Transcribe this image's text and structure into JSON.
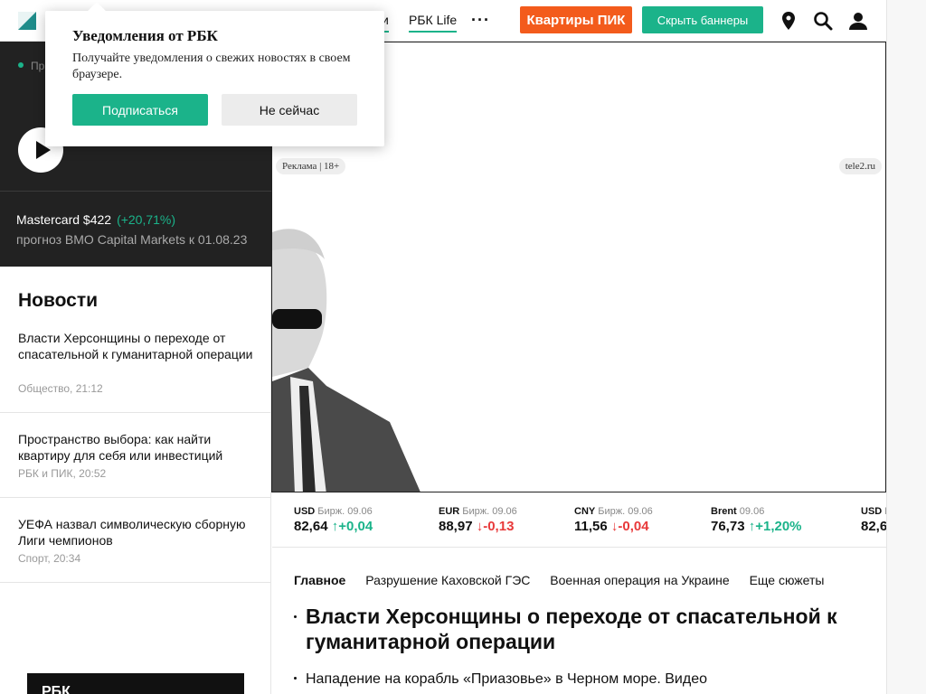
{
  "header": {
    "nav_partial_label": "и",
    "nav_rbc_life": "РБК Life",
    "more_label": "···",
    "promo_button": "Квартиры ПИК",
    "hide_banners_button": "Скрыть баннеры"
  },
  "popup": {
    "title": "Уведомления от РБК",
    "text": "Получайте уведомления о свежих новостях в своем браузере.",
    "subscribe_button": "Подписаться",
    "dismiss_button": "Не сейчас"
  },
  "live": {
    "label_partial": "Пр"
  },
  "ticker": {
    "name_price": "Mastercard $422",
    "change": "(+20,71%)",
    "note": "прогноз BMO Capital Markets к 01.08.23"
  },
  "news": {
    "title": "Новости",
    "items": [
      {
        "text": "Власти Херсонщины о переходе от спасательной к гуманитарной операции",
        "meta": "Общество, 21:12"
      },
      {
        "text": "Пространство выбора: как найти квартиру для себя или инвестиций",
        "meta": "РБК и ПИК, 20:52"
      },
      {
        "text": "УЕФА назвал символическую сборную Лиги чемпионов",
        "meta": "Спорт, 20:34"
      }
    ],
    "bottom_logo": "РБК"
  },
  "banner": {
    "ad_tag": "Реклама | 18+",
    "ad_site": "tele2.ru"
  },
  "rates": [
    {
      "code": "USD",
      "source": "Бирж. 09.06",
      "value": "82,64",
      "arrow": "↑",
      "change": "+0,04",
      "dir": "up"
    },
    {
      "code": "EUR",
      "source": "Бирж. 09.06",
      "value": "88,97",
      "arrow": "↓",
      "change": "-0,13",
      "dir": "down"
    },
    {
      "code": "CNY",
      "source": "Бирж. 09.06",
      "value": "11,56",
      "arrow": "↓",
      "change": "-0,04",
      "dir": "down"
    },
    {
      "code": "Brent",
      "source": "09.06",
      "value": "76,73",
      "arrow": "↑",
      "change": "+1,20%",
      "dir": "up"
    },
    {
      "code": "USD",
      "source": "Б",
      "value": "82,6",
      "arrow": "",
      "change": "",
      "dir": "up"
    }
  ],
  "stories": {
    "tabs": [
      "Главное",
      "Разрушение Каховской ГЭС",
      "Военная операция на Украине",
      "Еще сюжеты"
    ],
    "main_headline": "Власти Херсонщины о переходе от спасательной к гуманитарной операции",
    "sub_headline": "Нападение на корабль «Приазовье» в Черном море. Видео"
  },
  "colors": {
    "accent_green": "#1bb38a",
    "promo_orange": "#f35b1c",
    "negative_red": "#e8393a",
    "dark_panel": "#222222"
  },
  "icons": [
    "logo-icon",
    "location-pin-icon",
    "search-icon",
    "user-icon",
    "play-icon",
    "arrow-up-icon",
    "arrow-down-icon"
  ]
}
